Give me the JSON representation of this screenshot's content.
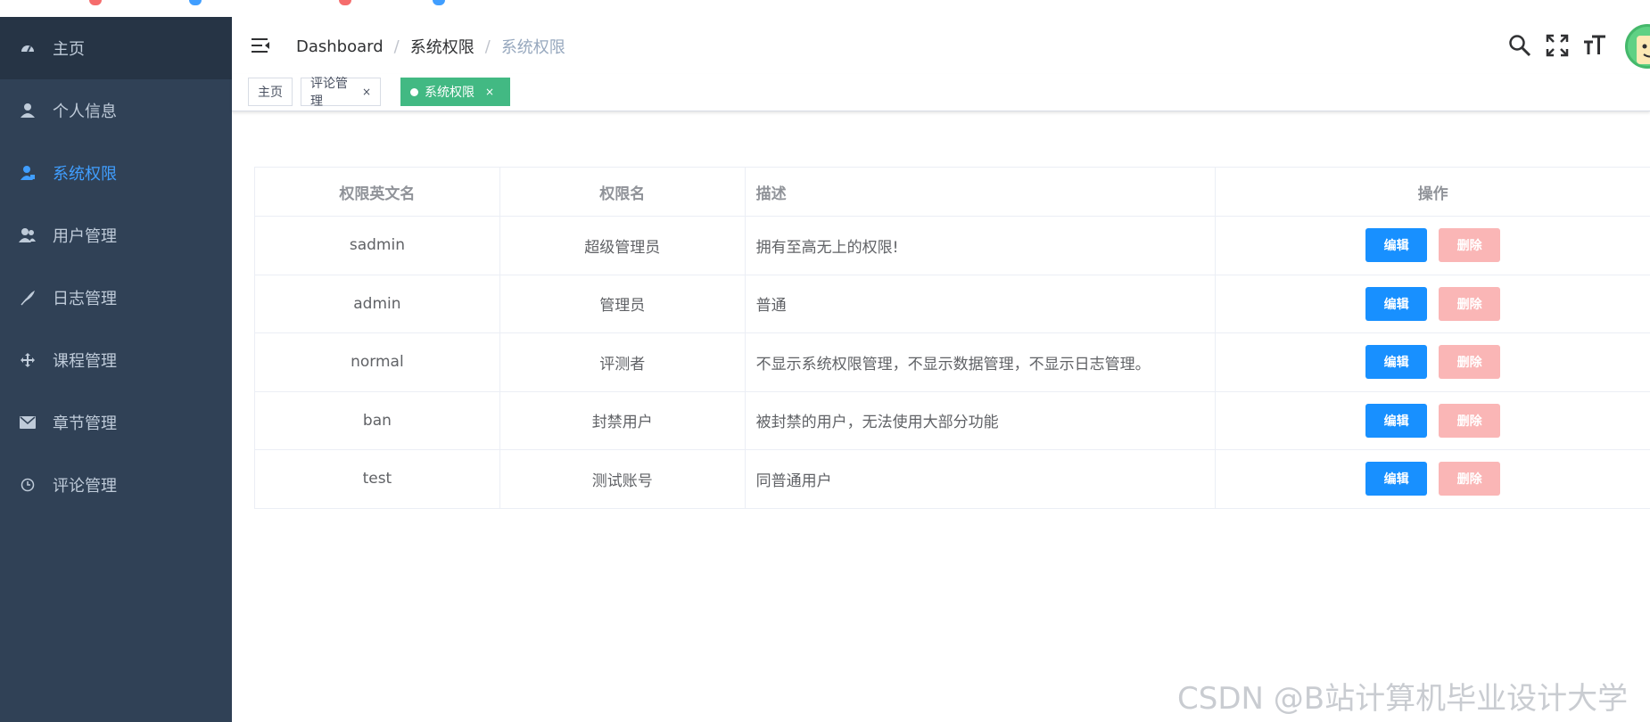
{
  "sidebar": {
    "items": [
      {
        "label": "主页",
        "icon": "dashboard-icon"
      },
      {
        "label": "个人信息",
        "icon": "user-icon"
      },
      {
        "label": "系统权限",
        "icon": "user-shield-icon"
      },
      {
        "label": "用户管理",
        "icon": "users-icon"
      },
      {
        "label": "日志管理",
        "icon": "feather-icon"
      },
      {
        "label": "课程管理",
        "icon": "move-icon"
      },
      {
        "label": "章节管理",
        "icon": "mail-icon"
      },
      {
        "label": "评论管理",
        "icon": "clock-icon"
      }
    ],
    "active_color": "#409eff"
  },
  "breadcrumb": {
    "items": [
      "Dashboard",
      "系统权限",
      "系统权限"
    ],
    "separator": "/"
  },
  "tags": [
    {
      "label": "主页"
    },
    {
      "label": "评论管理",
      "close": "×"
    },
    {
      "label": "系统权限",
      "close": "×",
      "active": true
    }
  ],
  "table": {
    "headers": [
      "权限英文名",
      "权限名",
      "描述",
      "操作"
    ],
    "rows": [
      {
        "en": "sadmin",
        "name": "超级管理员",
        "desc": "拥有至高无上的权限!"
      },
      {
        "en": "admin",
        "name": "管理员",
        "desc": "普通"
      },
      {
        "en": "normal",
        "name": "评测者",
        "desc": "不显示系统权限管理，不显示数据管理，不显示日志管理。"
      },
      {
        "en": "ban",
        "name": "封禁用户",
        "desc": "被封禁的用户，无法使用大部分功能"
      },
      {
        "en": "test",
        "name": "测试账号",
        "desc": "同普通用户"
      }
    ],
    "edit_label": "编辑",
    "delete_label": "删除"
  },
  "watermark": "CSDN @B站计算机毕业设计大学",
  "colors": {
    "sidebar_bg": "#304156",
    "tag_active": "#42b983",
    "edit_button": "#1890ff",
    "delete_button": "#fab6b6"
  }
}
